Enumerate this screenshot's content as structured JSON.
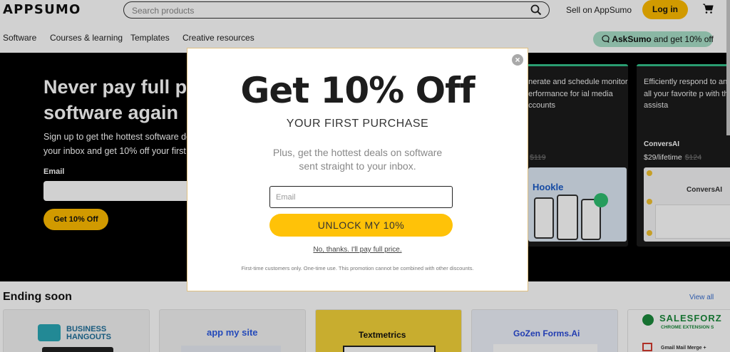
{
  "header": {
    "logo": "APPSUMO",
    "search_placeholder": "Search products",
    "sell_label": "Sell on AppSumo",
    "login_label": "Log in"
  },
  "nav": {
    "items": [
      "Software",
      "Courses & learning",
      "Templates",
      "Creative resources"
    ],
    "asksumo_bold": "AskSumo",
    "asksumo_rest": " and get 10% off"
  },
  "hero": {
    "title_line1": "Never pay full pr",
    "title_line2": "software again",
    "subtitle_line1": "Sign up to get the hottest software de",
    "subtitle_line2": "your inbox and get 10% off your first",
    "email_label": "Email",
    "button_label": "Get 10% Off"
  },
  "cards": [
    {
      "desc": "enerate and schedule monitor performance for ial media accounts",
      "name": "",
      "price": "",
      "old_price": "$119",
      "img_label": "Hookle"
    },
    {
      "desc": "Efficiently respond to any across all your favorite p with this AI chat assista",
      "name": "ConversAI",
      "price": "$29/lifetime",
      "old_price": "$124",
      "img_label": "ConversAI"
    }
  ],
  "modal": {
    "title": "Get 10% Off",
    "subtitle": "YOUR FIRST PURCHASE",
    "desc_line1": "Plus, get the hottest deals on software",
    "desc_line2": "sent straight to your inbox.",
    "email_placeholder": "Email",
    "unlock_label": "UNLOCK MY 10%",
    "no_thanks": "No, thanks. I'll pay full price.",
    "fine_print": "First-time customers only. One-time use. This promotion cannot be combined with other discounts."
  },
  "ending_soon": {
    "title": "Ending soon",
    "view_all": "View all",
    "cards": [
      {
        "name": "BUSINESS HANGOUTS",
        "color": "#1f6f9a"
      },
      {
        "name": "app my site",
        "color": "#2d5be3"
      },
      {
        "name": "Textmetrics",
        "color": "#111111"
      },
      {
        "name": "GoZen Forms.Ai",
        "color": "#2a4bd8"
      },
      {
        "name": "SALESFORZ",
        "color": "#1c8a3c"
      }
    ],
    "salesforz_sub": "CHROME EXTENSION S",
    "gmail_merge": "Gmail Mail Merge +"
  },
  "colors": {
    "accent": "#ffbc00",
    "hero_bg": "#000000",
    "card_border": "#32c08a",
    "asksumo_bg": "#a9e0c8"
  }
}
